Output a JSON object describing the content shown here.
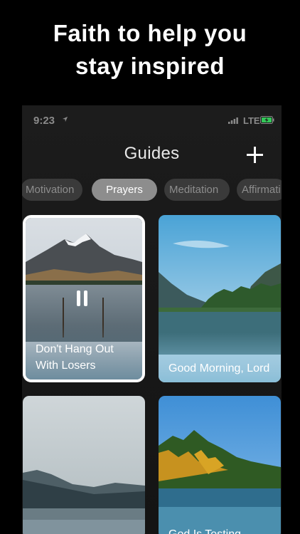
{
  "promo": {
    "line1": "Faith to help you",
    "line2": "stay inspired"
  },
  "status_bar": {
    "time": "9:23",
    "network": "LTE"
  },
  "nav": {
    "title": "Guides"
  },
  "tabs": [
    {
      "label": "Motivation"
    },
    {
      "label": "Prayers",
      "active": true
    },
    {
      "label": "Meditation"
    },
    {
      "label": "Affirmati"
    }
  ],
  "cards": [
    {
      "title": "Don't Hang Out With Losers",
      "playing": true
    },
    {
      "title": "Good Morning, Lord"
    },
    {
      "title": ""
    },
    {
      "title": "God Is Testing"
    }
  ],
  "icons": {
    "add": "plus-icon",
    "pause": "pause-icon",
    "location": "location-arrow-icon",
    "signal": "signal-bars-icon",
    "battery": "battery-charging-icon"
  },
  "colors": {
    "background": "#000000",
    "tab_active": "#8d8d8d",
    "tab_inactive": "#3a3a3a",
    "battery": "#34c759"
  }
}
